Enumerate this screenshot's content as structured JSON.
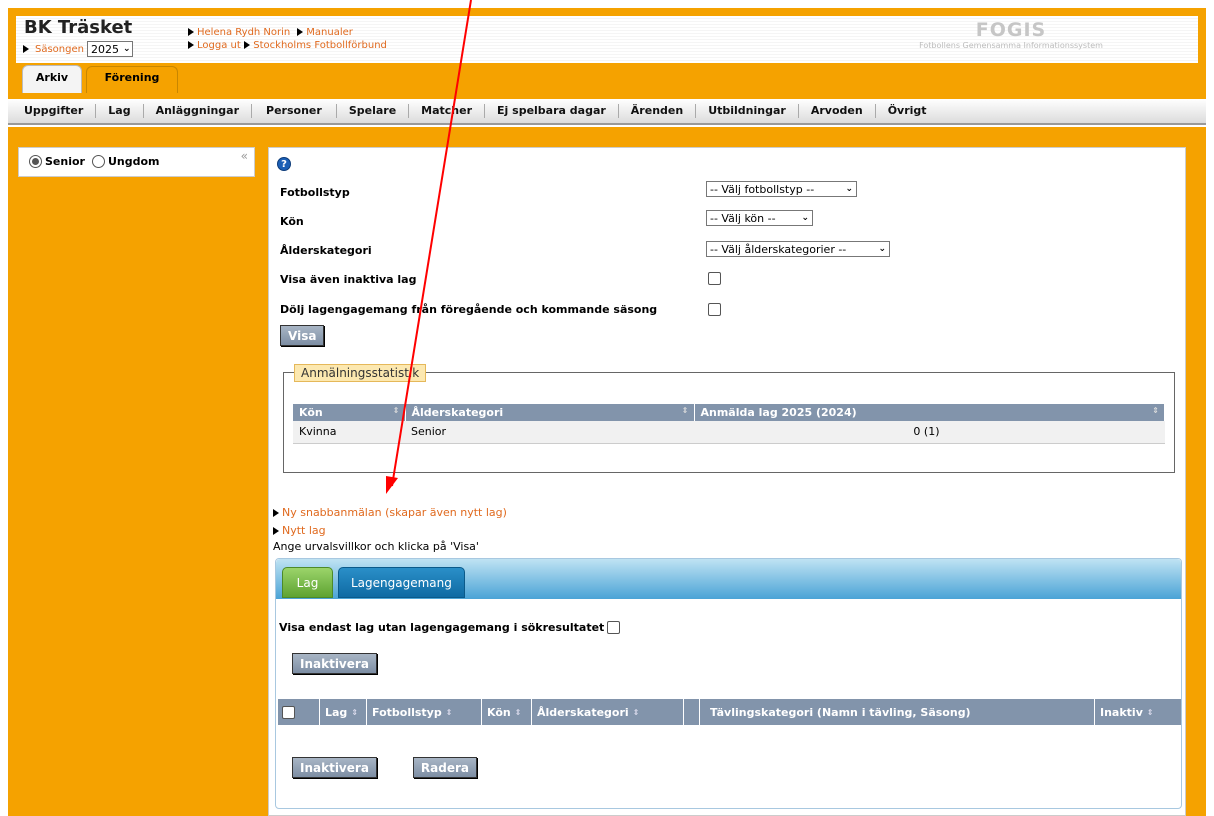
{
  "header": {
    "club_name": "BK Träsket",
    "season_label": "Säsongen",
    "season_value": "2025",
    "user_name": "Helena Rydh Norin",
    "manuals": "Manualer",
    "logout": "Logga ut",
    "federation": "Stockholms Fotbollförbund",
    "logo_title": "FOGIS",
    "logo_subtitle": "Fotbollens Gemensamma Informationssystem",
    "tabs": [
      "Arkiv",
      "Förening"
    ]
  },
  "nav": [
    "Uppgifter",
    "Lag",
    "Anläggningar",
    "Personer",
    "Spelare",
    "Matcher",
    "Ej spelbara dagar",
    "Ärenden",
    "Utbildningar",
    "Arvoden",
    "Övrigt"
  ],
  "sidebar": {
    "senior": "Senior",
    "youth": "Ungdom",
    "collapse": "«"
  },
  "form": {
    "football_type_label": "Fotbollstyp",
    "football_type_value": "-- Välj fotbollstyp --",
    "gender_label": "Kön",
    "gender_value": "-- Välj kön --",
    "age_label": "Ålderskategori",
    "age_value": "-- Välj ålderskategorier --",
    "inactive_label": "Visa även inaktiva lag",
    "hide_label": "Dölj lagengagemang från föregående och kommande säsong",
    "show_button": "Visa"
  },
  "stats": {
    "legend": "Anmälningsstatistik",
    "headers": [
      "Kön",
      "Ålderskategori",
      "Anmälda lag 2025 (2024)"
    ],
    "rows": [
      [
        "Kvinna",
        "Senior",
        "0 (1)"
      ]
    ]
  },
  "links": {
    "quick_registration": "Ny snabbanmälan (skapar även nytt lag)",
    "new_team": "Nytt lag",
    "hint": "Ange urvalsvillkor och klicka på 'Visa'"
  },
  "tabs": {
    "lag": "Lag",
    "lagengagemang": "Lagengagemang"
  },
  "results": {
    "only_without_label": "Visa endast lag utan lagengagemang i sökresultatet",
    "inactivate_button": "Inaktivera",
    "delete_button": "Radera",
    "columns": [
      "Lag",
      "Fotbollstyp",
      "Kön",
      "Ålderskategori",
      "Tävlingskategori (Namn i tävling, Säsong)",
      "Inaktiv"
    ]
  },
  "colors": {
    "brand_orange": "#f5a200",
    "link_orange": "#e06a1f",
    "table_header": "#8294ab",
    "annotation_arrow": "#ff0000"
  }
}
